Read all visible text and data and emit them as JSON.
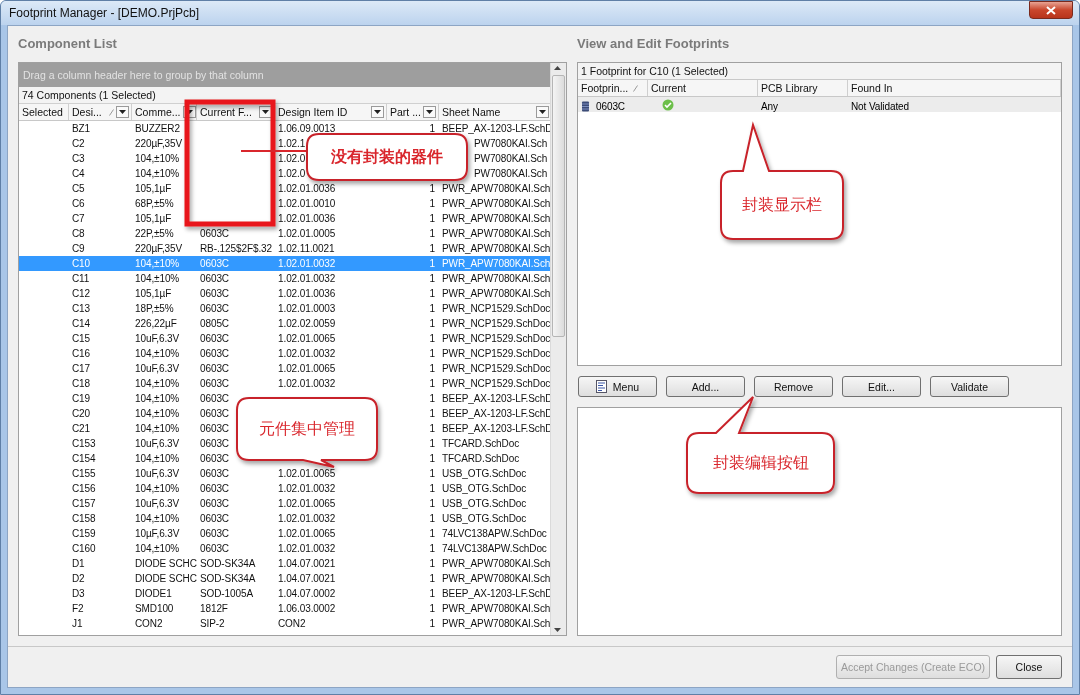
{
  "window": {
    "title": "Footprint Manager - [DEMO.PrjPcb]"
  },
  "component_list": {
    "title": "Component List",
    "group_hint": "Drag a column header here to group by that column",
    "count": "74 Components (1 Selected)",
    "columns": [
      {
        "label": "Selected",
        "filter": false,
        "sorted": false
      },
      {
        "label": "Desi...",
        "filter": true,
        "sorted": true
      },
      {
        "label": "Comme...",
        "filter": true,
        "sorted": false
      },
      {
        "label": "Current F...",
        "filter": true,
        "sorted": false
      },
      {
        "label": "Design Item ID",
        "filter": true,
        "sorted": false
      },
      {
        "label": "Part ...",
        "filter": true,
        "sorted": false
      },
      {
        "label": "Sheet Name",
        "filter": true,
        "sorted": false
      }
    ],
    "rows": [
      {
        "selected": false,
        "cells": [
          "",
          "BZ1",
          "BUZZER2",
          "",
          "1.06.09.0013",
          "1",
          "BEEP_AX-1203-LF.SchD"
        ]
      },
      {
        "selected": false,
        "cells": [
          "",
          "C2",
          "220µF,35V",
          "",
          "1.02.1",
          "",
          "PW7080KAI.Sch"
        ]
      },
      {
        "selected": false,
        "cells": [
          "",
          "C3",
          "104,±10%",
          "",
          "1.02.0",
          "",
          "PW7080KAI.Sch"
        ]
      },
      {
        "selected": false,
        "cells": [
          "",
          "C4",
          "104,±10%",
          "",
          "1.02.0",
          "",
          "PW7080KAI.Sch"
        ]
      },
      {
        "selected": false,
        "cells": [
          "",
          "C5",
          "105,1µF",
          "",
          "1.02.01.0036",
          "1",
          "PWR_APW7080KAI.Sch"
        ]
      },
      {
        "selected": false,
        "cells": [
          "",
          "C6",
          "68P,±5%",
          "",
          "1.02.01.0010",
          "1",
          "PWR_APW7080KAI.Sch"
        ]
      },
      {
        "selected": false,
        "cells": [
          "",
          "C7",
          "105,1µF",
          "",
          "1.02.01.0036",
          "1",
          "PWR_APW7080KAI.Sch"
        ]
      },
      {
        "selected": false,
        "cells": [
          "",
          "C8",
          "22P,±5%",
          "0603C",
          "1.02.01.0005",
          "1",
          "PWR_APW7080KAI.Sch"
        ]
      },
      {
        "selected": false,
        "cells": [
          "",
          "C9",
          "220µF,35V",
          "RB-.125$2F$.32",
          "1.02.11.0021",
          "1",
          "PWR_APW7080KAI.Sch"
        ]
      },
      {
        "selected": true,
        "cells": [
          "",
          "C10",
          "104,±10%",
          "0603C",
          "1.02.01.0032",
          "1",
          "PWR_APW7080KAI.Sch"
        ]
      },
      {
        "selected": false,
        "cells": [
          "",
          "C11",
          "104,±10%",
          "0603C",
          "1.02.01.0032",
          "1",
          "PWR_APW7080KAI.Sch"
        ]
      },
      {
        "selected": false,
        "cells": [
          "",
          "C12",
          "105,1µF",
          "0603C",
          "1.02.01.0036",
          "1",
          "PWR_APW7080KAI.Sch"
        ]
      },
      {
        "selected": false,
        "cells": [
          "",
          "C13",
          "18P,±5%",
          "0603C",
          "1.02.01.0003",
          "1",
          "PWR_NCP1529.SchDoc"
        ]
      },
      {
        "selected": false,
        "cells": [
          "",
          "C14",
          "226,22µF",
          "0805C",
          "1.02.02.0059",
          "1",
          "PWR_NCP1529.SchDoc"
        ]
      },
      {
        "selected": false,
        "cells": [
          "",
          "C15",
          "10uF,6.3V",
          "0603C",
          "1.02.01.0065",
          "1",
          "PWR_NCP1529.SchDoc"
        ]
      },
      {
        "selected": false,
        "cells": [
          "",
          "C16",
          "104,±10%",
          "0603C",
          "1.02.01.0032",
          "1",
          "PWR_NCP1529.SchDoc"
        ]
      },
      {
        "selected": false,
        "cells": [
          "",
          "C17",
          "10uF,6.3V",
          "0603C",
          "1.02.01.0065",
          "1",
          "PWR_NCP1529.SchDoc"
        ]
      },
      {
        "selected": false,
        "cells": [
          "",
          "C18",
          "104,±10%",
          "0603C",
          "1.02.01.0032",
          "1",
          "PWR_NCP1529.SchDoc"
        ]
      },
      {
        "selected": false,
        "cells": [
          "",
          "C19",
          "104,±10%",
          "0603C",
          "",
          "1",
          "BEEP_AX-1203-LF.SchD"
        ]
      },
      {
        "selected": false,
        "cells": [
          "",
          "C20",
          "104,±10%",
          "0603C",
          "",
          "1",
          "BEEP_AX-1203-LF.SchD"
        ]
      },
      {
        "selected": false,
        "cells": [
          "",
          "C21",
          "104,±10%",
          "0603C",
          "",
          "1",
          "BEEP_AX-1203-LF.SchD"
        ]
      },
      {
        "selected": false,
        "cells": [
          "",
          "C153",
          "10uF,6.3V",
          "0603C",
          "",
          "1",
          "TFCARD.SchDoc"
        ]
      },
      {
        "selected": false,
        "cells": [
          "",
          "C154",
          "104,±10%",
          "0603C",
          "",
          "1",
          "TFCARD.SchDoc"
        ]
      },
      {
        "selected": false,
        "cells": [
          "",
          "C155",
          "10uF,6.3V",
          "0603C",
          "1.02.01.0065",
          "1",
          "USB_OTG.SchDoc"
        ]
      },
      {
        "selected": false,
        "cells": [
          "",
          "C156",
          "104,±10%",
          "0603C",
          "1.02.01.0032",
          "1",
          "USB_OTG.SchDoc"
        ]
      },
      {
        "selected": false,
        "cells": [
          "",
          "C157",
          "10uF,6.3V",
          "0603C",
          "1.02.01.0065",
          "1",
          "USB_OTG.SchDoc"
        ]
      },
      {
        "selected": false,
        "cells": [
          "",
          "C158",
          "104,±10%",
          "0603C",
          "1.02.01.0032",
          "1",
          "USB_OTG.SchDoc"
        ]
      },
      {
        "selected": false,
        "cells": [
          "",
          "C159",
          "10µF,6.3V",
          "0603C",
          "1.02.01.0065",
          "1",
          "74LVC138APW.SchDoc"
        ]
      },
      {
        "selected": false,
        "cells": [
          "",
          "C160",
          "104,±10%",
          "0603C",
          "1.02.01.0032",
          "1",
          "74LVC138APW.SchDoc"
        ]
      },
      {
        "selected": false,
        "cells": [
          "",
          "D1",
          "DIODE SCHC",
          "SOD-SK34A",
          "1.04.07.0021",
          "1",
          "PWR_APW7080KAI.Sch"
        ]
      },
      {
        "selected": false,
        "cells": [
          "",
          "D2",
          "DIODE SCHC",
          "SOD-SK34A",
          "1.04.07.0021",
          "1",
          "PWR_APW7080KAI.Sch"
        ]
      },
      {
        "selected": false,
        "cells": [
          "",
          "D3",
          "DIODE1",
          "SOD-1005A",
          "1.04.07.0002",
          "1",
          "BEEP_AX-1203-LF.SchD"
        ]
      },
      {
        "selected": false,
        "cells": [
          "",
          "F2",
          "SMD100",
          "1812F",
          "1.06.03.0002",
          "1",
          "PWR_APW7080KAI.Sch"
        ]
      },
      {
        "selected": false,
        "cells": [
          "",
          "J1",
          "CON2",
          "SIP-2",
          "CON2",
          "1",
          "PWR_APW7080KAI.Sch"
        ]
      }
    ]
  },
  "footprints": {
    "title": "View and Edit Footprints",
    "summary": "1 Footprint for C10 (1 Selected)",
    "columns": [
      {
        "label": "Footprin...",
        "sorted": true
      },
      {
        "label": "Current",
        "sorted": false
      },
      {
        "label": "PCB Library",
        "sorted": false
      },
      {
        "label": "Found In",
        "sorted": false
      }
    ],
    "rows": [
      {
        "selected": true,
        "name": "0603C",
        "current": true,
        "library": "Any",
        "found_in": "Not Validated"
      }
    ],
    "buttons": [
      {
        "label": "Menu",
        "kind": "menu"
      },
      {
        "label": "Add...",
        "kind": "plain"
      },
      {
        "label": "Remove",
        "kind": "plain"
      },
      {
        "label": "Edit...",
        "kind": "plain"
      },
      {
        "label": "Validate",
        "kind": "plain"
      }
    ]
  },
  "footer_buttons": [
    {
      "label": "Accept Changes (Create ECO)",
      "disabled": true
    },
    {
      "label": "Close",
      "disabled": false
    }
  ],
  "annotations": [
    {
      "kind": "leader",
      "text": "没有封装的器件"
    },
    {
      "kind": "bubble",
      "text": "元件集中管理"
    },
    {
      "kind": "bubble",
      "text": "封装显示栏"
    },
    {
      "kind": "bubble",
      "text": "封装编辑按钮"
    }
  ]
}
